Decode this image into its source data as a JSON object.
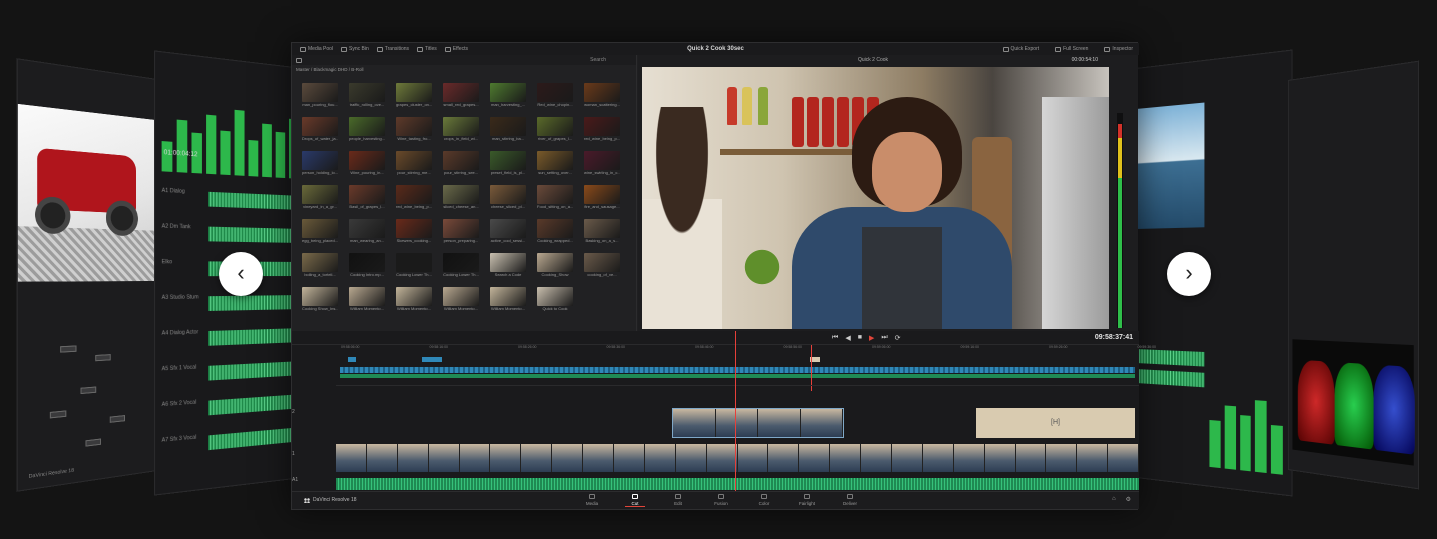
{
  "carousel": {
    "prev_glyph": "‹",
    "next_glyph": "›",
    "prev_icon": "chevron-left-icon",
    "next_icon": "chevron-right-icon"
  },
  "window": {
    "title": "Quick 2 Cook 30sec",
    "toolbar_left": [
      "Media Pool",
      "Sync Bin",
      "Transitions",
      "Titles",
      "Effects"
    ],
    "toolbar_right": [
      "Quick Export",
      "Full Screen",
      "Inspector"
    ]
  },
  "media_pool": {
    "search": "Search",
    "path": "Master / Blackmagic DHD / B-Roll",
    "clips": [
      "man_pouring_flou...",
      "traffic_rolling_ove...",
      "grapes_cluster_on...",
      "small_red_grapes...",
      "man_harvesting_...",
      "Red_wine_chopin...",
      "woman_scattering...",
      "Drops_of_water_ja...",
      "people_harvesting...",
      "Wine_tasting_fro...",
      "crops_in_field_wi...",
      "man_stirring_ba...",
      "river_of_grapes_l...",
      "red_wine_being_p...",
      "person_holding_lo...",
      "Wine_pouring_in...",
      "pour_stirring_me...",
      "pour_stirring_see...",
      "preset_field_is_pl...",
      "sun_setting_over...",
      "wine_swirling_in_c...",
      "vineyard_in_a_gr...",
      "Basil_of_grapes_l...",
      "red_wine_being_p...",
      "sliced_cheese_an...",
      "cheese_sliced_pl...",
      "Food_sitting_on_a...",
      "fire_and_sausage...",
      "egg_being_placed...",
      "man_wearing_an...",
      "Skewers_cooking...",
      "person_preparing...",
      "active_cool_sessi...",
      "Cooking_wrapped...",
      "Basking_on_a_s...",
      "boiling_a_torteli...",
      "Cooking Intro.mp...",
      "Cooking Lower Th...",
      "Cooking Lower Th...",
      "Search a Code",
      "Cooking_Show",
      "cooking_of_ve...",
      "Cooking Show_Ins...",
      "William Momento...",
      "William Momento...",
      "William Momento...",
      "William Momento...",
      "Quick to Cook"
    ],
    "clip_colors": [
      "#5a4a3c",
      "#3a3a2c",
      "#6e7a3a",
      "#6a2a2a",
      "#4e7a2f",
      "#2c1a1a",
      "#6a3a1a",
      "#6a3a2a",
      "#4a6a2a",
      "#5e3a2a",
      "#6a7a3a",
      "#3a2a1a",
      "#5a6a2a",
      "#4a1a1a",
      "#2a3a6a",
      "#6a2a1a",
      "#6a4a2a",
      "#5a3a2a",
      "#3a5a2a",
      "#7a5a2a",
      "#4a1a2a",
      "#6a6a3a",
      "#6a3a2a",
      "#5a2a1a",
      "#6a6a4a",
      "#7a5a3a",
      "#6a4a3a",
      "#8a4a1a",
      "#6a5a3a",
      "#3a3a3a",
      "#6a2a1a",
      "#7a4a3a",
      "#4a4a4a",
      "#5a3a2a",
      "#6a5a4a",
      "#7a6a4a",
      "#111111",
      "#1a1a1a",
      "#111111",
      "#c9c0b0",
      "#b9a890",
      "#6a5a4a",
      "#c2b49a",
      "#b8a890",
      "#c2b49a",
      "#b8a890",
      "#c2b49a",
      "#c9bfae"
    ]
  },
  "viewer": {
    "timeline_name": "Quick 2 Cook",
    "timecode_top": "00:00:54:10",
    "timecode": "09:58:37:41"
  },
  "timeline": {
    "ruler": [
      "09:58:06:00",
      "09:58:16:00",
      "09:58:26:00",
      "09:58:36:00",
      "09:58:46:00",
      "09:58:56:00",
      "09:59:06:00",
      "09:59:16:00",
      "09:59:26:00",
      "09:59:36:00"
    ],
    "tracks": [
      {
        "num": "2"
      },
      {
        "num": "1"
      },
      {
        "num": "A1"
      }
    ],
    "title_clip_glyph": "[H]"
  },
  "pages": {
    "brand": "DaVinci Resolve 18",
    "tabs": [
      {
        "label": "Media",
        "active": false
      },
      {
        "label": "Cut",
        "active": true
      },
      {
        "label": "Edit",
        "active": false
      },
      {
        "label": "Fusion",
        "active": false
      },
      {
        "label": "Color",
        "active": false
      },
      {
        "label": "Fairlight",
        "active": false
      },
      {
        "label": "Deliver",
        "active": false
      }
    ]
  },
  "side_panels": {
    "left_timecode": "01:00:04:12",
    "left_brand": "DaVinci Resolve 18",
    "track_names": [
      "A1 Dialog",
      "A2 Dm Tank",
      "Elko",
      "A3 Studio Stum",
      "A4 Dialog Actor",
      "A5 Sfx 1 Vocal",
      "A6 Sfx 2 Vocal",
      "A7 Sfx 3 Vocal"
    ]
  }
}
